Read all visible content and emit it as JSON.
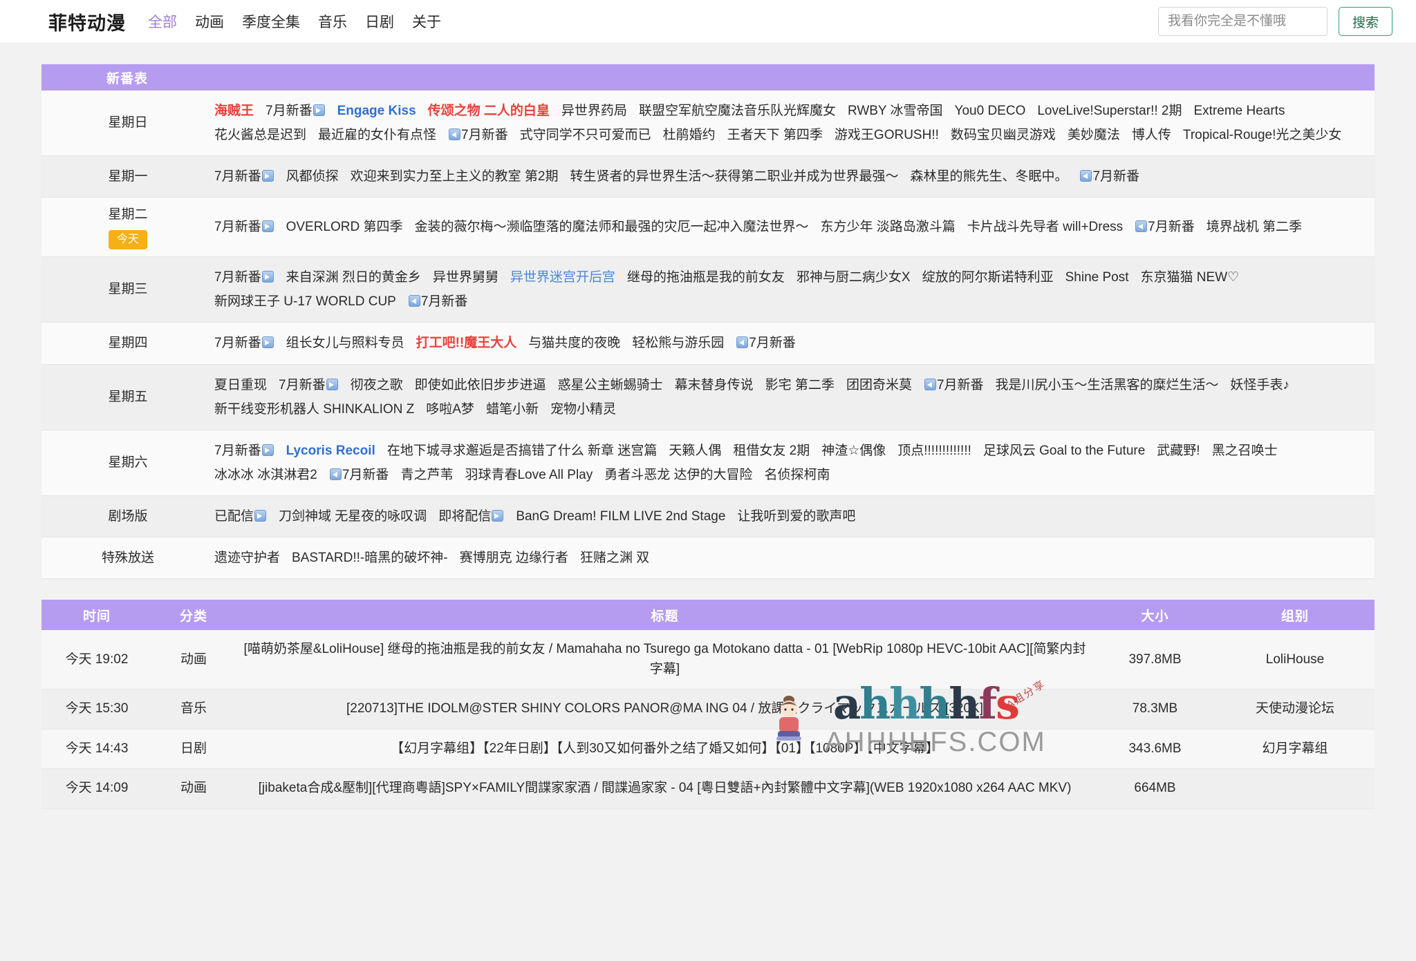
{
  "header": {
    "brand": "菲特动漫",
    "nav": [
      {
        "label": "全部",
        "active": true
      },
      {
        "label": "动画",
        "active": false
      },
      {
        "label": "季度全集",
        "active": false
      },
      {
        "label": "音乐",
        "active": false
      },
      {
        "label": "日剧",
        "active": false
      },
      {
        "label": "关于",
        "active": false
      }
    ],
    "search": {
      "placeholder": "我看你完全是不懂哦",
      "value": "",
      "button": "搜索"
    }
  },
  "schedule": {
    "panel_title": "新番表",
    "today_badge": "今天",
    "rows": [
      {
        "day": "星期日",
        "today": false,
        "items": [
          {
            "text": "海贼王",
            "style": "red"
          },
          {
            "text": "7月新番",
            "style": "plain",
            "arrow": "right"
          },
          {
            "text": "Engage Kiss",
            "style": "blue"
          },
          {
            "text": "传颂之物 二人的白皇",
            "style": "red"
          },
          {
            "text": "异世界药局",
            "style": "plain"
          },
          {
            "text": "联盟空军航空魔法音乐队光辉魔女",
            "style": "plain"
          },
          {
            "text": "RWBY 冰雪帝国",
            "style": "plain"
          },
          {
            "text": "You0 DECO",
            "style": "plain"
          },
          {
            "text": "LoveLive!Superstar!! 2期",
            "style": "plain"
          },
          {
            "text": "Extreme Hearts",
            "style": "plain"
          },
          {
            "text": "花火酱总是迟到",
            "style": "plain"
          },
          {
            "text": "最近雇的女仆有点怪",
            "style": "plain"
          },
          {
            "text": "7月新番",
            "style": "plain",
            "arrow": "left"
          },
          {
            "text": "式守同学不只可爱而已",
            "style": "plain"
          },
          {
            "text": "杜鹃婚约",
            "style": "plain"
          },
          {
            "text": "王者天下 第四季",
            "style": "plain"
          },
          {
            "text": "游戏王GORUSH!!",
            "style": "plain"
          },
          {
            "text": "数码宝贝幽灵游戏",
            "style": "plain"
          },
          {
            "text": "美妙魔法",
            "style": "plain"
          },
          {
            "text": "博人传",
            "style": "plain"
          },
          {
            "text": "Tropical-Rouge!光之美少女",
            "style": "plain"
          }
        ]
      },
      {
        "day": "星期一",
        "today": false,
        "items": [
          {
            "text": "7月新番",
            "style": "plain",
            "arrow": "right"
          },
          {
            "text": "风都侦探",
            "style": "plain"
          },
          {
            "text": "欢迎来到实力至上主义的教室 第2期",
            "style": "plain"
          },
          {
            "text": "转生贤者的异世界生活～获得第二职业并成为世界最强～",
            "style": "plain"
          },
          {
            "text": "森林里的熊先生、冬眠中。",
            "style": "plain"
          },
          {
            "text": "7月新番",
            "style": "plain",
            "arrow": "left"
          }
        ]
      },
      {
        "day": "星期二",
        "today": true,
        "items": [
          {
            "text": "7月新番",
            "style": "plain",
            "arrow": "right"
          },
          {
            "text": "OVERLORD 第四季",
            "style": "plain"
          },
          {
            "text": "金装的薇尔梅～濒临堕落的魔法师和最强的灾厄一起冲入魔法世界～",
            "style": "plain"
          },
          {
            "text": "东方少年 淡路岛激斗篇",
            "style": "plain"
          },
          {
            "text": "卡片战斗先导者 will+Dress",
            "style": "plain"
          },
          {
            "text": "7月新番",
            "style": "plain",
            "arrow": "left"
          },
          {
            "text": "境界战机 第二季",
            "style": "plain"
          }
        ]
      },
      {
        "day": "星期三",
        "today": false,
        "items": [
          {
            "text": "7月新番",
            "style": "plain",
            "arrow": "right"
          },
          {
            "text": "来自深渊 烈日的黄金乡",
            "style": "plain"
          },
          {
            "text": "异世界舅舅",
            "style": "plain"
          },
          {
            "text": "异世界迷宫开后宫",
            "style": "lblue"
          },
          {
            "text": "继母的拖油瓶是我的前女友",
            "style": "plain"
          },
          {
            "text": "邪神与厨二病少女X",
            "style": "plain"
          },
          {
            "text": "绽放的阿尔斯诺特利亚",
            "style": "plain"
          },
          {
            "text": "Shine Post",
            "style": "plain"
          },
          {
            "text": "东京猫猫 NEW♡",
            "style": "plain"
          },
          {
            "text": "新网球王子 U-17 WORLD CUP",
            "style": "plain"
          },
          {
            "text": "7月新番",
            "style": "plain",
            "arrow": "left"
          }
        ]
      },
      {
        "day": "星期四",
        "today": false,
        "items": [
          {
            "text": "7月新番",
            "style": "plain",
            "arrow": "right"
          },
          {
            "text": "组长女儿与照料专员",
            "style": "plain"
          },
          {
            "text": "打工吧!!魔王大人",
            "style": "red"
          },
          {
            "text": "与猫共度的夜晚",
            "style": "plain"
          },
          {
            "text": "轻松熊与游乐园",
            "style": "plain"
          },
          {
            "text": "7月新番",
            "style": "plain",
            "arrow": "left"
          }
        ]
      },
      {
        "day": "星期五",
        "today": false,
        "items": [
          {
            "text": "夏日重现",
            "style": "plain"
          },
          {
            "text": "7月新番",
            "style": "plain",
            "arrow": "right"
          },
          {
            "text": "彻夜之歌",
            "style": "plain"
          },
          {
            "text": "即使如此依旧步步进逼",
            "style": "plain"
          },
          {
            "text": "惑星公主蜥蜴骑士",
            "style": "plain"
          },
          {
            "text": "幕末替身传说",
            "style": "plain"
          },
          {
            "text": "影宅 第二季",
            "style": "plain"
          },
          {
            "text": "团团奇米莫",
            "style": "plain"
          },
          {
            "text": "7月新番",
            "style": "plain",
            "arrow": "left"
          },
          {
            "text": "我是川尻小玉～生活黑客的糜烂生活～",
            "style": "plain"
          },
          {
            "text": "妖怪手表♪",
            "style": "plain"
          },
          {
            "text": "新干线变形机器人 SHINKALION Z",
            "style": "plain"
          },
          {
            "text": "哆啦A梦",
            "style": "plain"
          },
          {
            "text": "蜡笔小新",
            "style": "plain"
          },
          {
            "text": "宠物小精灵",
            "style": "plain"
          }
        ]
      },
      {
        "day": "星期六",
        "today": false,
        "items": [
          {
            "text": "7月新番",
            "style": "plain",
            "arrow": "right"
          },
          {
            "text": "Lycoris Recoil",
            "style": "blue"
          },
          {
            "text": "在地下城寻求邂逅是否搞错了什么 新章 迷宫篇",
            "style": "plain"
          },
          {
            "text": "天籁人偶",
            "style": "plain"
          },
          {
            "text": "租借女友 2期",
            "style": "plain"
          },
          {
            "text": "神渣☆偶像",
            "style": "plain"
          },
          {
            "text": "顶点!!!!!!!!!!!!!",
            "style": "plain"
          },
          {
            "text": "足球风云 Goal to the Future",
            "style": "plain"
          },
          {
            "text": "武藏野!",
            "style": "plain"
          },
          {
            "text": "黑之召唤士",
            "style": "plain"
          },
          {
            "text": "冰冰冰 冰淇淋君2",
            "style": "plain"
          },
          {
            "text": "7月新番",
            "style": "plain",
            "arrow": "left"
          },
          {
            "text": "青之芦苇",
            "style": "plain"
          },
          {
            "text": "羽球青春Love All Play",
            "style": "plain"
          },
          {
            "text": "勇者斗恶龙 达伊的大冒险",
            "style": "plain"
          },
          {
            "text": "名侦探柯南",
            "style": "plain"
          }
        ]
      },
      {
        "day": "剧场版",
        "today": false,
        "items": [
          {
            "text": "已配信",
            "style": "plain",
            "arrow": "right"
          },
          {
            "text": "刀剑神域 无星夜的咏叹调",
            "style": "plain"
          },
          {
            "text": "即将配信",
            "style": "plain",
            "arrow": "right"
          },
          {
            "text": "BanG Dream! FILM LIVE 2nd Stage",
            "style": "plain"
          },
          {
            "text": "让我听到爱的歌声吧",
            "style": "plain"
          }
        ]
      },
      {
        "day": "特殊放送",
        "today": false,
        "items": [
          {
            "text": "遗迹守护者",
            "style": "plain"
          },
          {
            "text": "BASTARD!!-暗黑的破坏神-",
            "style": "plain"
          },
          {
            "text": "赛博朋克 边缘行者",
            "style": "plain"
          },
          {
            "text": "狂赌之渊 双",
            "style": "plain"
          }
        ]
      }
    ]
  },
  "watermark": {
    "logo": "ahhhhfs",
    "domain": "AHHHHFS.COM",
    "tag": "A姐分享"
  },
  "downloads": {
    "columns": [
      "时间",
      "分类",
      "标题",
      "大小",
      "组别"
    ],
    "rows": [
      {
        "time": "今天 19:02",
        "category": "动画",
        "category_color": "anime",
        "title": "[喵萌奶茶屋&LoliHouse] 继母的拖油瓶是我的前女友 / Mamahaha no Tsurego ga Motokano datta - 01 [WebRip 1080p HEVC-10bit AAC][简繁内封字幕]",
        "size": "397.8MB",
        "group": "LoliHouse"
      },
      {
        "time": "今天 15:30",
        "category": "音乐",
        "category_color": "music",
        "title": "[220713]THE IDOLM@STER SHINY COLORS PANOR@MA ING 04 / 放課後クライマックスガールズ [320K]",
        "size": "78.3MB",
        "group": "天使动漫论坛"
      },
      {
        "time": "今天 14:43",
        "category": "日剧",
        "category_color": "drama",
        "title": "【幻月字幕组】【22年日剧】【人到30又如何番外之结了婚又如何】【01】【1080P】【中文字幕】",
        "size": "343.6MB",
        "group": "幻月字幕组"
      },
      {
        "time": "今天 14:09",
        "category": "动画",
        "category_color": "anime",
        "title": "[jibaketa合成&壓制][代理商粵語]SPY×FAMILY間諜家家酒 / 間諜過家家 - 04 [粵日雙語+內封繁體中文字幕](WEB 1920x1080 x264 AAC MKV)",
        "size": "664MB",
        "group": ""
      }
    ]
  }
}
